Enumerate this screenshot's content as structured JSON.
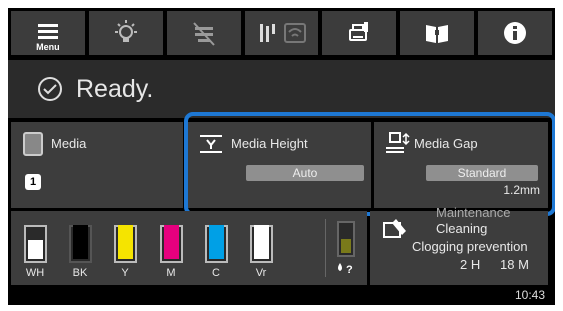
{
  "toolbar": {
    "menu_label": "Menu",
    "icons": [
      "menu-icon",
      "light-bulb-icon",
      "network-disabled-icon",
      "wifi-direct-icon",
      "printer-maintenance-icon",
      "manual-book-icon",
      "info-icon"
    ]
  },
  "status": {
    "text": "Ready."
  },
  "media": {
    "label": "Media",
    "number": "1"
  },
  "media_height": {
    "label": "Media Height",
    "value": "Auto"
  },
  "media_gap": {
    "label": "Media Gap",
    "value": "Standard",
    "measure": "1.2mm"
  },
  "inks": [
    {
      "label": "WH",
      "color": "#ffffff",
      "level": 0.55
    },
    {
      "label": "BK",
      "color": "#000000",
      "level": 1.0
    },
    {
      "label": "Y",
      "color": "#f5e400",
      "level": 1.0
    },
    {
      "label": "M",
      "color": "#e6007e",
      "level": 1.0
    },
    {
      "label": "C",
      "color": "#00a0e6",
      "level": 1.0
    },
    {
      "label": "Vr",
      "color": "#ffffff",
      "level": 1.0
    }
  ],
  "waste_ink": {
    "icon": "waste-ink-icon",
    "color": "#7a7a1a",
    "level": 0.45
  },
  "maintenance": {
    "title": "Maintenance",
    "line1": "Cleaning",
    "line2": "Clogging prevention",
    "hours": "2 H",
    "minutes": "18 M"
  },
  "time": "10:43",
  "colors": {
    "highlight": "#1e78d4",
    "toolbar_bg": "#3c3c3c",
    "panel_bg": "#3d3d3d"
  }
}
